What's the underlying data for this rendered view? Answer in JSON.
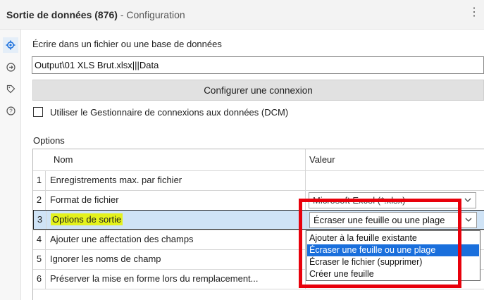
{
  "window": {
    "title": "Sortie de données (876)",
    "subtitle": " - Configuration"
  },
  "leftbar": {
    "icons": [
      "gear-icon",
      "arrow-circle-icon",
      "tag-icon",
      "help-icon"
    ]
  },
  "output": {
    "write_label": "Écrire dans un fichier ou une base de données",
    "path_value": "Output\\01 XLS Brut.xlsx|||Data",
    "configure_button": "Configurer une connexion",
    "dcm_label": "Utiliser le Gestionnaire de connexions aux données (DCM)",
    "dcm_checked": false
  },
  "options": {
    "section_label": "Options",
    "col_name": "Nom",
    "col_value": "Valeur",
    "rows": [
      {
        "num": "1",
        "name": "Enregistrements max. par fichier",
        "value": ""
      },
      {
        "num": "2",
        "name": "Format de fichier",
        "value": "Microsoft Excel (*.xlsx)"
      },
      {
        "num": "3",
        "name": "Options de sortie",
        "value": "Écraser une feuille ou une plage"
      },
      {
        "num": "4",
        "name": "Ajouter une affectation des champs",
        "value": ""
      },
      {
        "num": "5",
        "name": "Ignorer les noms de champ",
        "value": ""
      },
      {
        "num": "6",
        "name": "Préserver la mise en forme lors du remplacement...",
        "value": ""
      }
    ]
  },
  "dropdown": {
    "options": [
      "Ajouter à la feuille existante",
      "Écraser une feuille ou une plage",
      "Écraser le fichier (supprimer)",
      "Créer une feuille"
    ],
    "selected_index": 1
  },
  "colors": {
    "selection_blue": "#1a6fdc",
    "highlight_yellow": "#e4f21c",
    "annotation_red": "#e8000b",
    "row_selected_bg": "#cfe3f6"
  }
}
